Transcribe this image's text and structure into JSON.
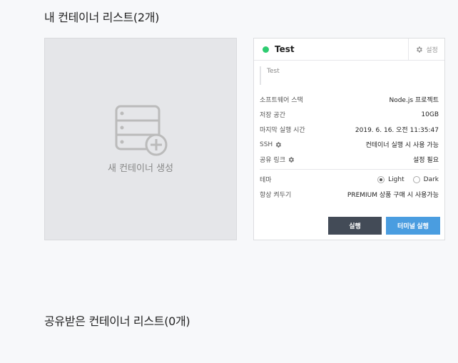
{
  "sections": {
    "mine_title": "내 컨테이너 리스트(2개)",
    "shared_title": "공유받은 컨테이너 리스트(0개)"
  },
  "new_container": {
    "label": "새 컨테이너 생성",
    "icon": "server-add-icon"
  },
  "container": {
    "name": "Test",
    "status_color": "#2ecc71",
    "settings_label": "설정",
    "description": "Test",
    "rows": [
      {
        "key": "소프트웨어 스택",
        "value": "Node.js 프로젝트"
      },
      {
        "key": "저장 공간",
        "value": "10GB"
      },
      {
        "key": "마지막 실행 시간",
        "value": "2019. 6. 16. 오전 11:35:47"
      },
      {
        "key": "SSH",
        "value": "컨테이너 실행 시 사용 가능"
      },
      {
        "key": "공유 링크",
        "value": "설정 필요"
      }
    ],
    "theme": {
      "key": "테마",
      "options": [
        "Light",
        "Dark"
      ],
      "selected": "Light"
    },
    "always_on": {
      "key": "항상 켜두기",
      "value": "PREMIUM 상품 구매 시 사용가능"
    },
    "run_label": "실행",
    "terminal_label": "터미널 실행"
  },
  "colors": {
    "run_button": "#434b57",
    "terminal_button": "#4a9de0",
    "status_running": "#2ecc71"
  }
}
